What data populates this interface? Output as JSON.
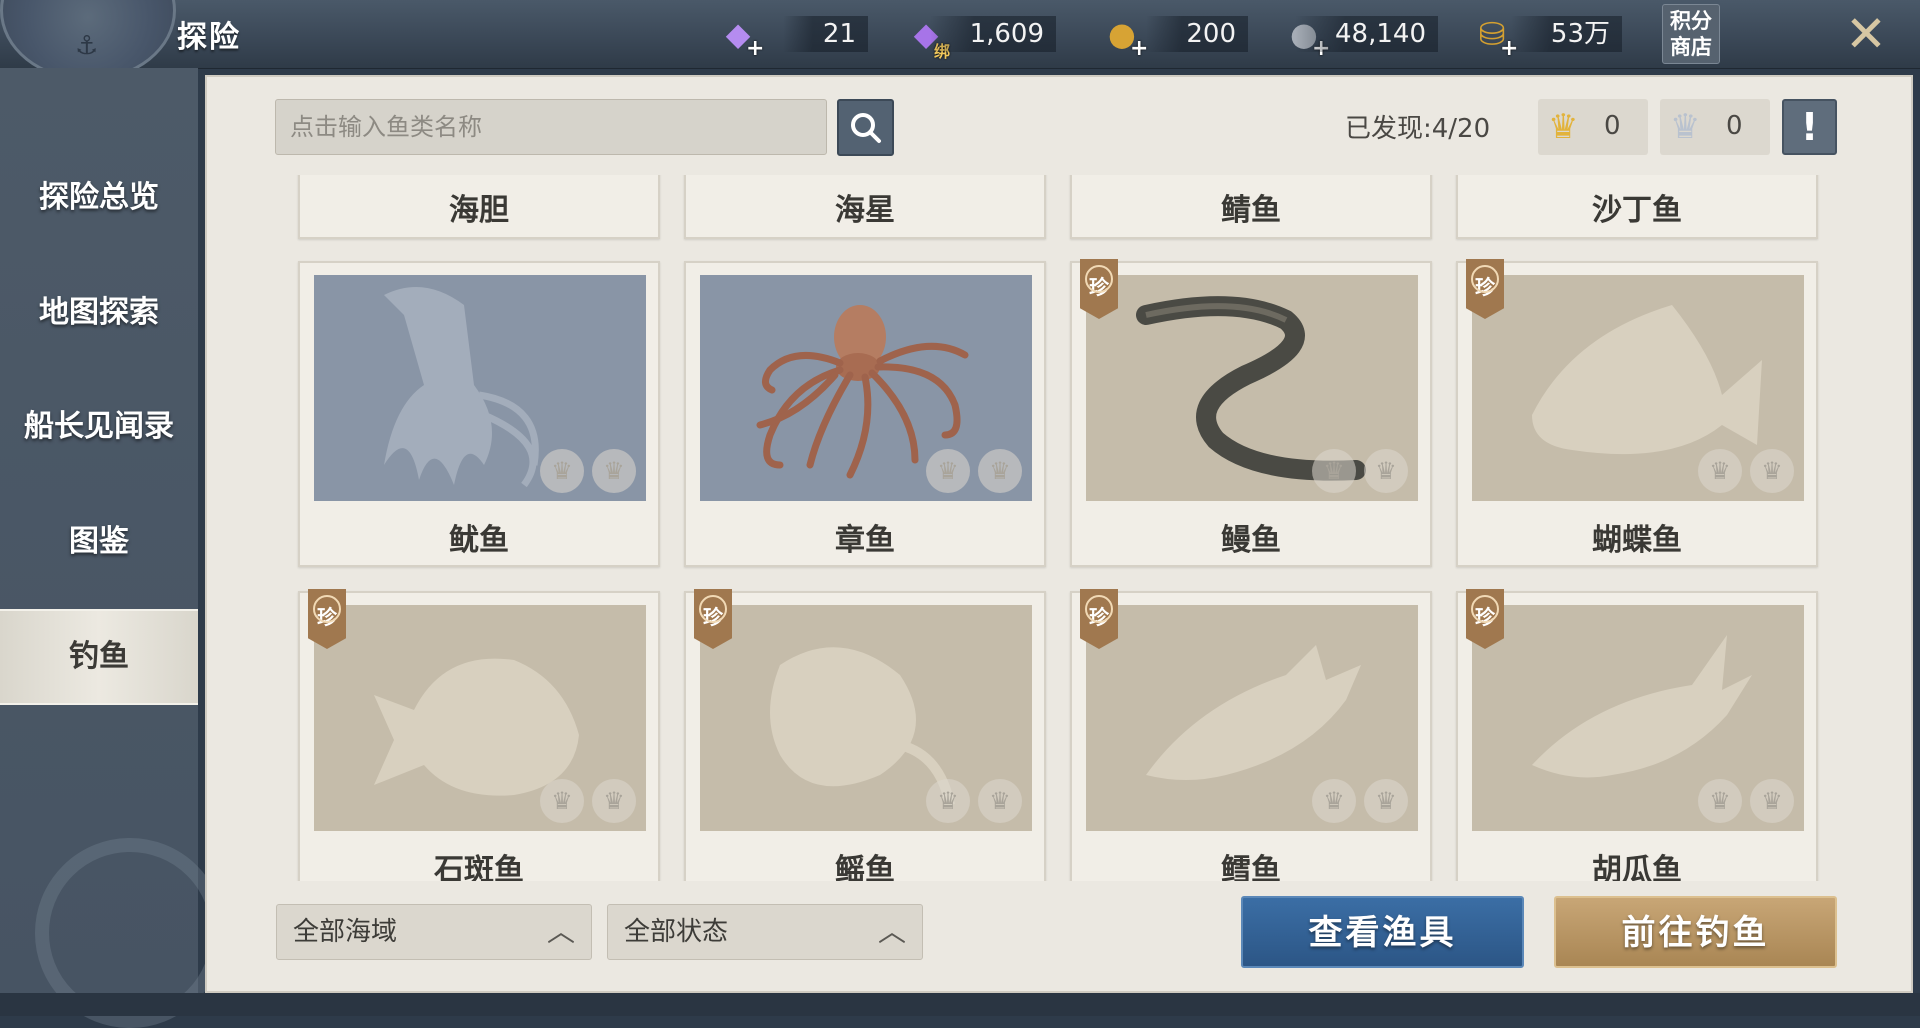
{
  "header": {
    "title": "探险",
    "shop_label": "积分商店",
    "currencies": [
      {
        "name": "diamond-icon",
        "value": "21",
        "color": "#b58cf0"
      },
      {
        "name": "bound-diamond-icon",
        "value": "1,609",
        "color": "#a774e8",
        "tag": "绑"
      },
      {
        "name": "gold-ship-coin-icon",
        "value": "200",
        "color": "#d7a334"
      },
      {
        "name": "silver-ship-coin-icon",
        "value": "48,140",
        "color": "#a6adb6"
      },
      {
        "name": "gold-coins-icon",
        "value": "53万",
        "color": "#d4a030"
      }
    ]
  },
  "sidebar": {
    "items": [
      {
        "label": "探险总览"
      },
      {
        "label": "地图探索"
      },
      {
        "label": "船长见闻录"
      },
      {
        "label": "图鉴"
      },
      {
        "label": "钓鱼",
        "active": true
      }
    ]
  },
  "toolbar": {
    "search_placeholder": "点击输入鱼类名称",
    "found_text": "已发现:4/20",
    "gold_crown_count": "0",
    "silver_crown_count": "0",
    "info_symbol": "!"
  },
  "fish": {
    "row0": [
      {
        "name": "海胆"
      },
      {
        "name": "海星"
      },
      {
        "name": "鲭鱼"
      },
      {
        "name": "沙丁鱼"
      }
    ],
    "row1": [
      {
        "name": "鱿鱼",
        "discovered": false,
        "rare": false,
        "bg": "blue"
      },
      {
        "name": "章鱼",
        "discovered": true,
        "rare": false,
        "bg": "blue"
      },
      {
        "name": "鳗鱼",
        "discovered": true,
        "rare": true,
        "bg": "tan"
      },
      {
        "name": "蝴蝶鱼",
        "discovered": false,
        "rare": true,
        "bg": "tan"
      }
    ],
    "row2": [
      {
        "name": "石斑鱼",
        "discovered": false,
        "rare": true,
        "bg": "tan"
      },
      {
        "name": "鳐鱼",
        "discovered": false,
        "rare": true,
        "bg": "tan"
      },
      {
        "name": "鳕鱼",
        "discovered": false,
        "rare": true,
        "bg": "tan"
      },
      {
        "name": "胡瓜鱼",
        "discovered": false,
        "rare": true,
        "bg": "tan"
      }
    ],
    "rare_badge": "珍"
  },
  "filters": {
    "region": "全部海域",
    "status": "全部状态"
  },
  "actions": {
    "view_gear": "查看渔具",
    "go_fishing": "前往钓鱼"
  }
}
